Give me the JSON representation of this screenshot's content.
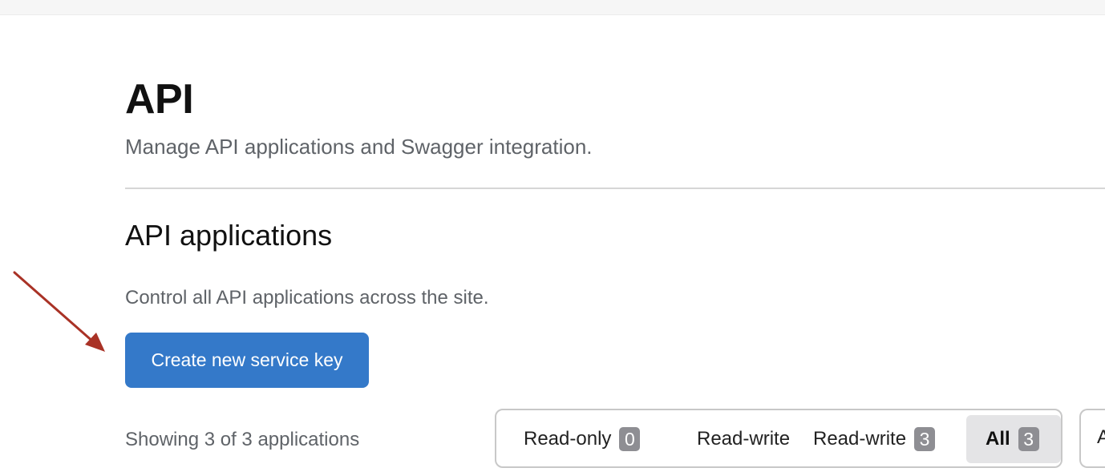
{
  "page": {
    "title": "API",
    "subtitle": "Manage API applications and Swagger integration."
  },
  "section": {
    "title": "API applications",
    "description": "Control all API applications across the site.",
    "create_button_label": "Create new service key",
    "showing_text": "Showing 3 of 3 applications"
  },
  "filters": [
    {
      "label": "Read-only",
      "count": "0",
      "active": false
    },
    {
      "label": "Read-write",
      "count": "",
      "active": false
    },
    {
      "label": "Read-write",
      "count": "3",
      "active": false
    },
    {
      "label": "All",
      "count": "3",
      "active": true
    }
  ],
  "second_filter_partial": "A",
  "colors": {
    "primary_button": "#3479c9",
    "arrow": "#a93226",
    "badge": "#8e8e93"
  },
  "icons": {
    "annotation_arrow": "arrow-icon"
  }
}
